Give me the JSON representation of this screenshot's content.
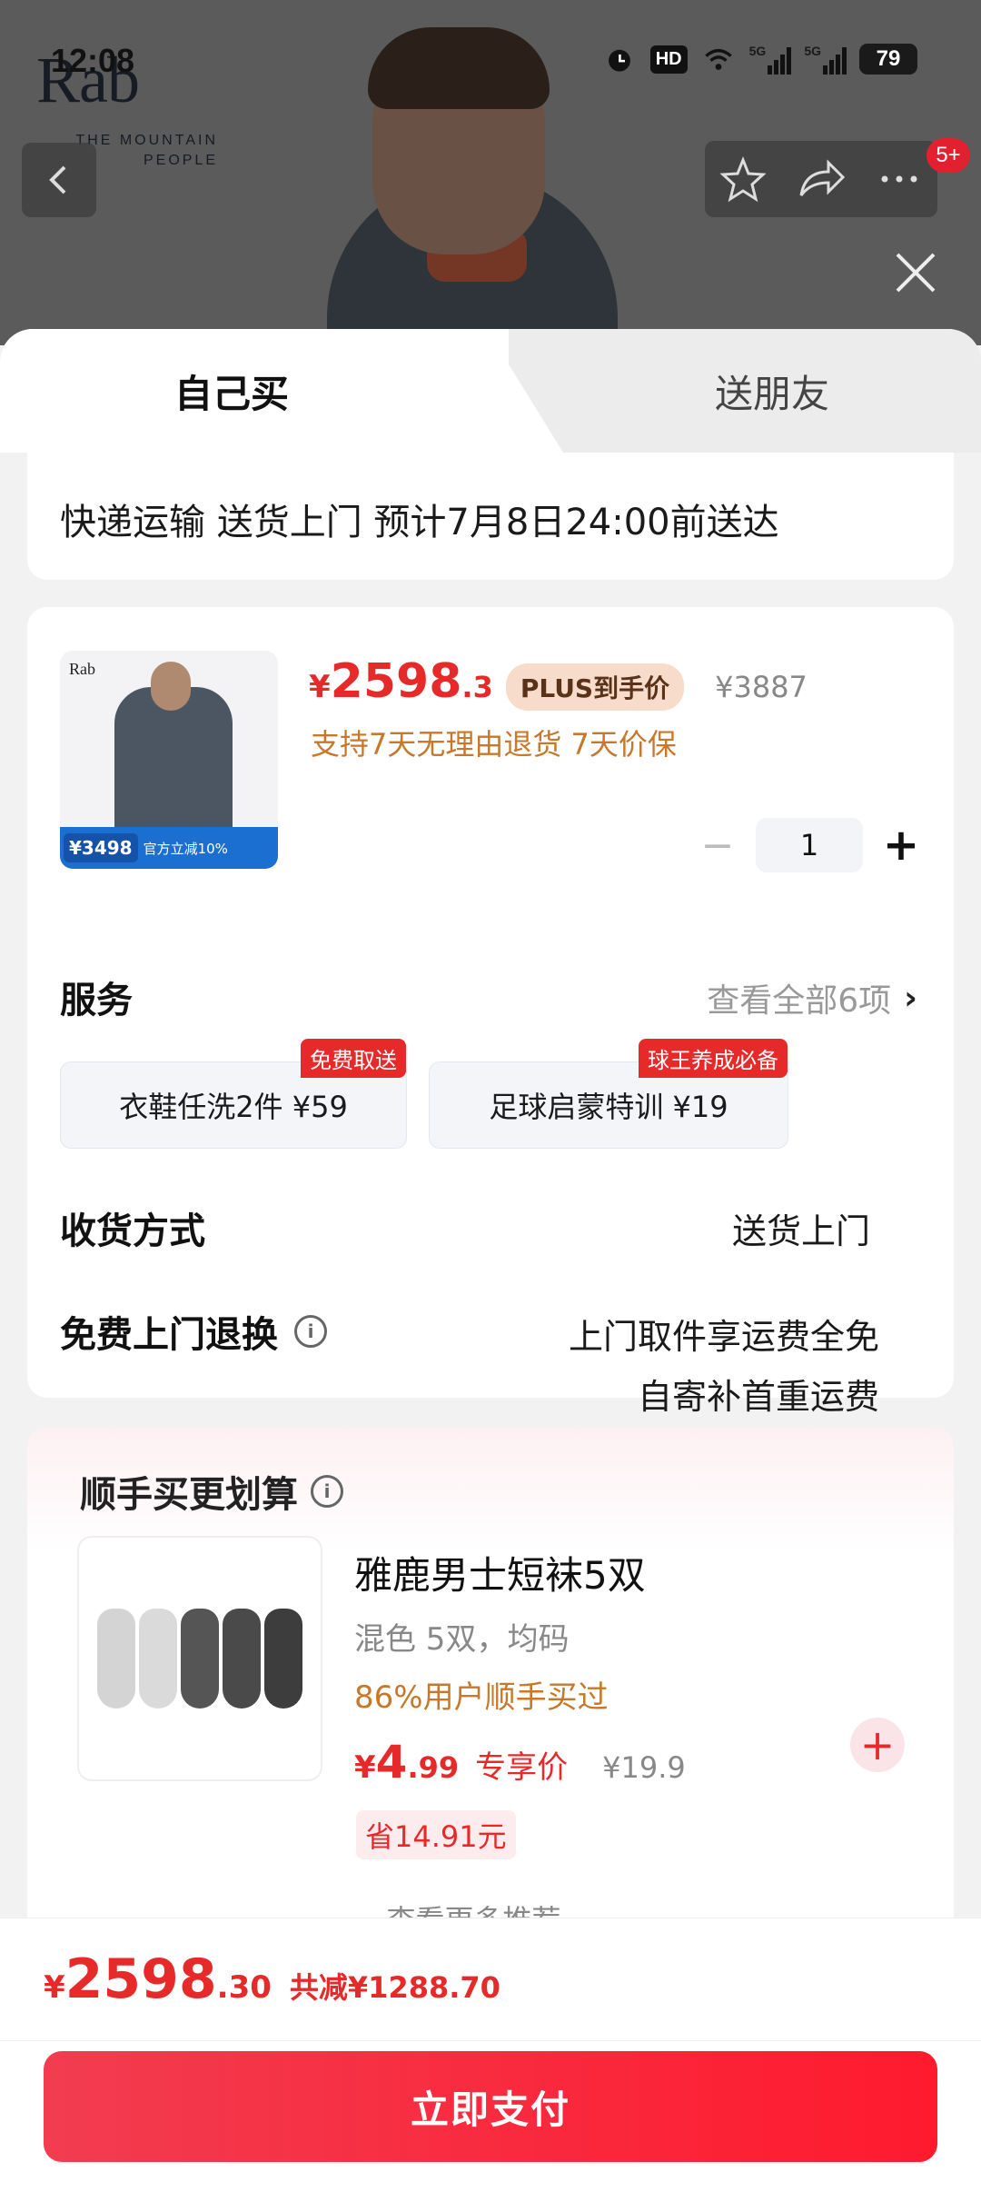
{
  "status_bar": {
    "time": "12:08",
    "network_label": "HD",
    "signal_1": "5G",
    "signal_2": "5G",
    "battery": "79"
  },
  "hero": {
    "brand_logo": "Rab",
    "brand_tagline_1": "THE MOUNTAIN",
    "brand_tagline_2": "PEOPLE",
    "notification_count": "5+"
  },
  "tabs": [
    {
      "label": "自己买",
      "active": true
    },
    {
      "label": "送朋友",
      "active": false
    }
  ],
  "delivery": {
    "text": "快递运输 送货上门 预计7月8日24:00前送达"
  },
  "product": {
    "thumb_logo": "Rab",
    "thumb_price": "¥3498",
    "thumb_promo": "官方立减10%",
    "price_currency": "¥",
    "price_int": "2598",
    "price_dec": ".3",
    "plus_tag": "PLUS到手价",
    "original_price": "¥3887",
    "return_policy": "支持7天无理由退货  7天价保",
    "quantity": "1",
    "qty_minus": "−",
    "qty_plus": "+"
  },
  "services": {
    "title": "服务",
    "view_all": "查看全部6项",
    "chevron": "›",
    "items": [
      {
        "label": "衣鞋任洗2件  ¥59",
        "badge": "免费取送"
      },
      {
        "label": "足球启蒙特训  ¥19",
        "badge": "球王养成必备"
      }
    ]
  },
  "shipping": {
    "title": "收货方式",
    "value": "送货上门"
  },
  "free_return": {
    "title": "免费上门退换",
    "info_glyph": "i",
    "line_1": "上门取件享运费全免",
    "line_2": "自寄补首重运费"
  },
  "addon": {
    "section_title": "顺手买更划算",
    "info_glyph": "i",
    "name": "雅鹿男士短袜5双",
    "spec": "混色 5双，均码",
    "popularity": "86%用户顺手买过",
    "price_currency": "¥",
    "price_int": "4",
    "price_dec": ".99",
    "price_label": "专享价",
    "original_price": "¥19.9",
    "save_badge": "省14.91元",
    "add_glyph": "+",
    "more_link": "查看更多推荐 ⌄",
    "sock_colors": [
      "#d4d4d4",
      "#dadada",
      "#555555",
      "#4a4a4a",
      "#3d3d3d"
    ]
  },
  "footer": {
    "total_currency": "¥",
    "total_int": "2598",
    "total_dec": ".30",
    "discount": "共减¥1288.70",
    "pay_button": "立即支付"
  },
  "colors": {
    "accent_red": "#e62a2a",
    "pay_gradient_start": "#f23c50",
    "pay_gradient_end": "#ff1a2e",
    "promo_orange": "#c7782b"
  }
}
